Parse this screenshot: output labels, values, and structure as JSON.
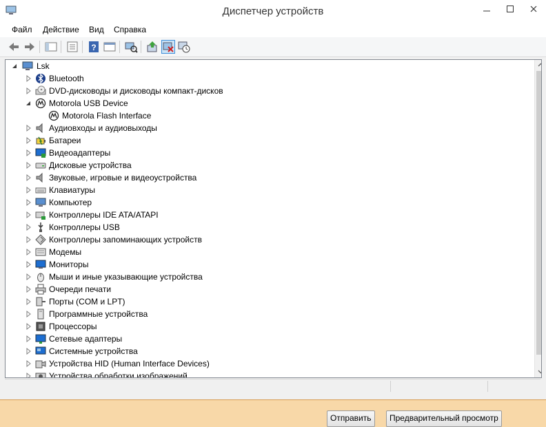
{
  "window": {
    "title": "Диспетчер устройств",
    "menu": [
      "Файл",
      "Действие",
      "Вид",
      "Справка"
    ]
  },
  "toolbar": {
    "buttons": [
      "back-icon",
      "forward-icon",
      "console-tree-icon",
      "properties-icon",
      "help-icon",
      "view-icon",
      "scan-hardware-icon",
      "update-driver-icon",
      "disable-device-icon",
      "uninstall-device-icon"
    ],
    "active_button": "disable-device-icon"
  },
  "tree": {
    "root": "Lsk",
    "items": [
      {
        "label": "Bluetooth",
        "icon": "bluetooth-icon",
        "expanded": false
      },
      {
        "label": "DVD-дисководы и дисководы компакт-дисков",
        "icon": "dvd-drive-icon",
        "expanded": false
      },
      {
        "label": "Motorola USB Device",
        "icon": "motorola-icon",
        "expanded": true
      },
      {
        "label": "Motorola Flash Interface",
        "icon": "motorola-icon",
        "child": true
      },
      {
        "label": "Аудиовходы и аудиовыходы",
        "icon": "speaker-icon",
        "expanded": false
      },
      {
        "label": "Батареи",
        "icon": "battery-icon",
        "expanded": false
      },
      {
        "label": "Видеоадаптеры",
        "icon": "display-adapter-icon",
        "expanded": false
      },
      {
        "label": "Дисковые устройства",
        "icon": "disk-drive-icon",
        "expanded": false
      },
      {
        "label": "Звуковые, игровые и видеоустройства",
        "icon": "speaker-icon",
        "expanded": false
      },
      {
        "label": "Клавиатуры",
        "icon": "keyboard-icon",
        "expanded": false
      },
      {
        "label": "Компьютер",
        "icon": "computer-icon",
        "expanded": false
      },
      {
        "label": "Контроллеры IDE ATA/ATAPI",
        "icon": "ide-controller-icon",
        "expanded": false
      },
      {
        "label": "Контроллеры USB",
        "icon": "usb-icon",
        "expanded": false
      },
      {
        "label": "Контроллеры запоминающих устройств",
        "icon": "storage-controller-icon",
        "expanded": false
      },
      {
        "label": "Модемы",
        "icon": "modem-icon",
        "expanded": false
      },
      {
        "label": "Мониторы",
        "icon": "monitor-icon",
        "expanded": false
      },
      {
        "label": "Мыши и иные указывающие устройства",
        "icon": "mouse-icon",
        "expanded": false
      },
      {
        "label": "Очереди печати",
        "icon": "printer-icon",
        "expanded": false
      },
      {
        "label": "Порты (COM и LPT)",
        "icon": "port-icon",
        "expanded": false
      },
      {
        "label": "Программные устройства",
        "icon": "software-device-icon",
        "expanded": false
      },
      {
        "label": "Процессоры",
        "icon": "processor-icon",
        "expanded": false
      },
      {
        "label": "Сетевые адаптеры",
        "icon": "network-adapter-icon",
        "expanded": false
      },
      {
        "label": "Системные устройства",
        "icon": "system-device-icon",
        "expanded": false
      },
      {
        "label": "Устройства HID (Human Interface Devices)",
        "icon": "hid-icon",
        "expanded": false
      },
      {
        "label": "Устройства обработки изображений",
        "icon": "imaging-device-icon",
        "expanded": false
      }
    ]
  },
  "background_buttons": {
    "send": "Отправить",
    "preview": "Предварительный просмотр"
  },
  "colors": {
    "background": "#f8d8a8",
    "accent": "#3c8dd8"
  }
}
